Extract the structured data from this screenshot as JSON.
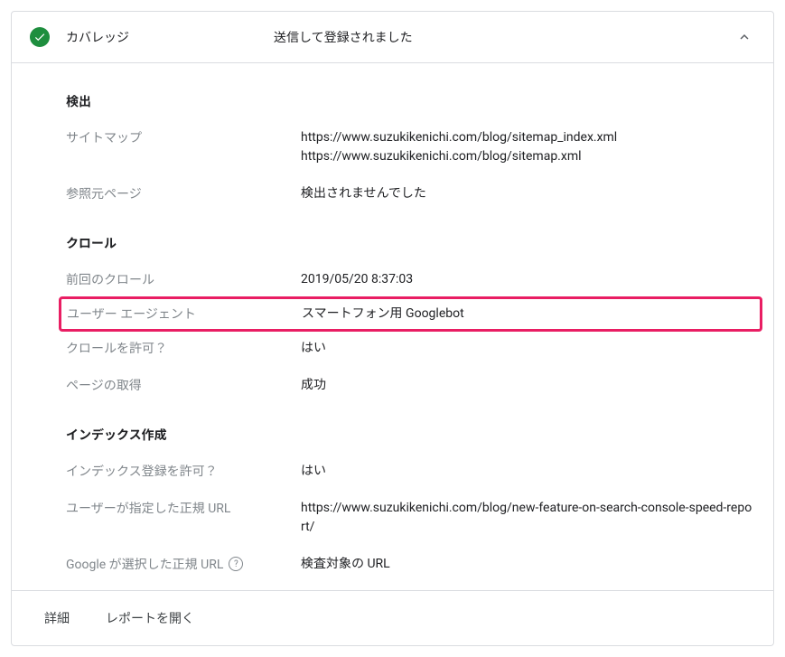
{
  "header": {
    "title": "カバレッジ",
    "status": "送信して登録されました"
  },
  "sections": {
    "discovery": {
      "title": "検出",
      "sitemap_label": "サイトマップ",
      "sitemap_value": "https://www.suzukikenichi.com/blog/sitemap_index.xml\nhttps://www.suzukikenichi.com/blog/sitemap.xml",
      "referrer_label": "参照元ページ",
      "referrer_value": "検出されませんでした"
    },
    "crawl": {
      "title": "クロール",
      "last_crawl_label": "前回のクロール",
      "last_crawl_value": "2019/05/20 8:37:03",
      "user_agent_label": "ユーザー エージェント",
      "user_agent_value": "スマートフォン用 Googlebot",
      "crawl_allowed_label": "クロールを許可？",
      "crawl_allowed_value": "はい",
      "page_fetch_label": "ページの取得",
      "page_fetch_value": "成功"
    },
    "indexing": {
      "title": "インデックス作成",
      "indexing_allowed_label": "インデックス登録を許可？",
      "indexing_allowed_value": "はい",
      "user_canonical_label": "ユーザーが指定した正規 URL",
      "user_canonical_value": "https://www.suzukikenichi.com/blog/new-feature-on-search-console-speed-report/",
      "google_canonical_label": "Google が選択した正規 URL",
      "google_canonical_value": "検査対象の URL"
    }
  },
  "footer": {
    "details": "詳細",
    "open_report": "レポートを開く"
  },
  "highlight_color": "#e91e63"
}
